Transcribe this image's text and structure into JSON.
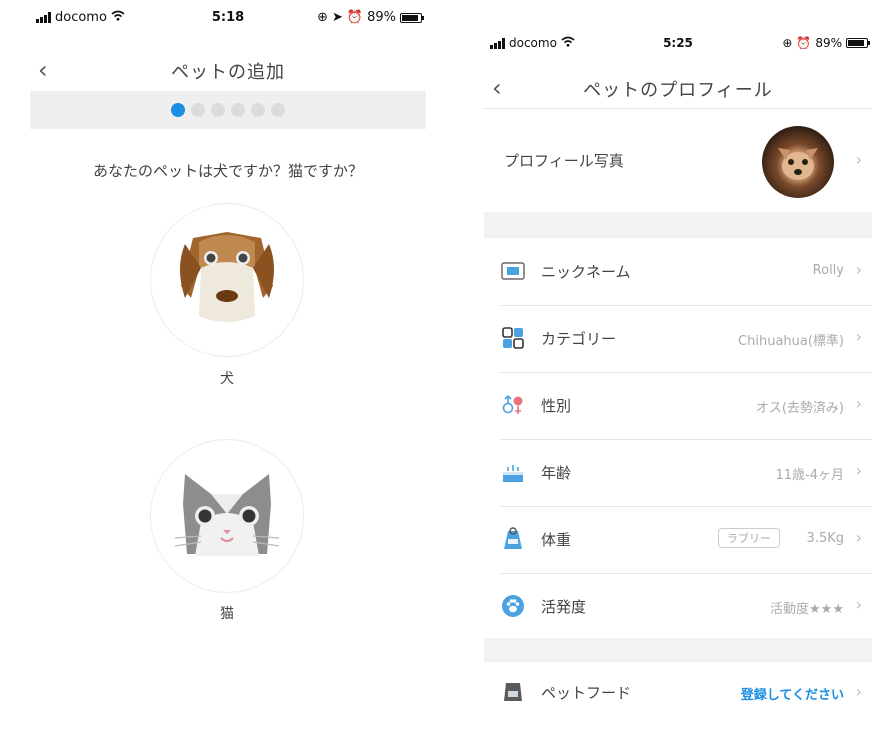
{
  "left": {
    "status": {
      "carrier": "docomo",
      "time": "5:18",
      "battery": "89%",
      "battery_level": 0.89
    },
    "nav": {
      "back_icon": "chevron-left-icon",
      "title": "ペットの追加"
    },
    "steps": {
      "total": 6,
      "current": 1
    },
    "question": "あなたのペットは犬ですか？猫ですか？",
    "choices": [
      {
        "label": "犬",
        "icon": "dog-face-icon"
      },
      {
        "label": "猫",
        "icon": "cat-face-icon"
      }
    ]
  },
  "right": {
    "status": {
      "carrier": "docomo",
      "time": "5:25",
      "battery": "89%",
      "battery_level": 0.89
    },
    "nav": {
      "back_icon": "chevron-left-icon",
      "title": "ペットのプロフィール"
    },
    "photo_row": {
      "label": "プロフィール写真"
    },
    "rows": [
      {
        "label": "ニックネーム",
        "value": "Rolly",
        "icon": "name-card-icon"
      },
      {
        "label": "カテゴリー",
        "value": "Chihuahua(標準)",
        "icon": "category-grid-icon"
      },
      {
        "label": "性別",
        "value": "オス(去勢済み)",
        "icon": "gender-icon"
      },
      {
        "label": "年齢",
        "value": "11歳-4ヶ月",
        "icon": "birthday-cake-icon"
      },
      {
        "label": "体重",
        "value": "3.5Kg",
        "tag": "ラブリー",
        "icon": "weight-icon"
      },
      {
        "label": "活発度",
        "value": "活動度★★★",
        "icon": "paw-icon"
      }
    ],
    "food_row": {
      "label": "ペットフード",
      "value": "登録してください",
      "icon": "pet-food-icon"
    },
    "chevron": "›",
    "colors": {
      "accent": "#1a8fe3",
      "separator": "#f2f2f2"
    }
  }
}
